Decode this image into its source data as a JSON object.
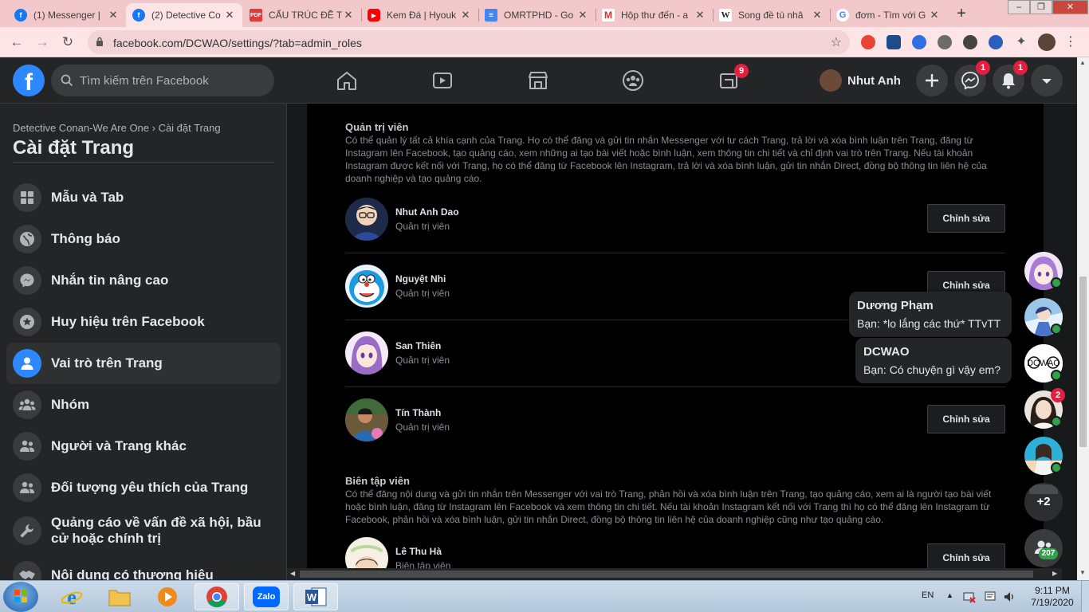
{
  "browser": {
    "tabs": [
      {
        "title": "(1) Messenger |",
        "favicon": "facebook-icon",
        "color": "#1877f2"
      },
      {
        "title": "(2) Detective Co",
        "favicon": "facebook-icon",
        "color": "#1877f2",
        "active": true
      },
      {
        "title": "CẤU TRÚC ĐỀ T",
        "favicon": "pdf-icon",
        "color": "#e53935"
      },
      {
        "title": "Kem Đá | Hyouk",
        "favicon": "youtube-icon",
        "color": "#ff0000"
      },
      {
        "title": "OMRTPHD - Go",
        "favicon": "docs-icon",
        "color": "#4285f4"
      },
      {
        "title": "Hộp thư đến - a",
        "favicon": "gmail-icon",
        "color": "#d93025"
      },
      {
        "title": "Song đề tù nhâ",
        "favicon": "wikipedia-icon",
        "color": "#555555"
      },
      {
        "title": "đơm - Tìm với G",
        "favicon": "google-icon",
        "color": "#4285f4"
      }
    ],
    "url": "facebook.com/DCWAO/settings/?tab=admin_roles"
  },
  "fb_header": {
    "search_placeholder": "Tìm kiếm trên Facebook",
    "groups_badge": "9",
    "profile_name": "Nhut Anh",
    "messenger_badge": "1",
    "notifications_badge": "1"
  },
  "sidebar": {
    "breadcrumb": "Detective Conan-We Are One › Cài đặt Trang",
    "title": "Cài đặt Trang",
    "items": [
      {
        "label": "Mẫu và Tab",
        "icon": "grid-icon"
      },
      {
        "label": "Thông báo",
        "icon": "globe-icon"
      },
      {
        "label": "Nhắn tin nâng cao",
        "icon": "messenger-icon"
      },
      {
        "label": "Huy hiệu trên Facebook",
        "icon": "star-badge-icon"
      },
      {
        "label": "Vai trò trên Trang",
        "icon": "person-icon",
        "active": true
      },
      {
        "label": "Nhóm",
        "icon": "group-icon"
      },
      {
        "label": "Người và Trang khác",
        "icon": "group-icon"
      },
      {
        "label": "Đối tượng yêu thích của Trang",
        "icon": "group-icon"
      },
      {
        "label": "Quảng cáo về vấn đề xã hội, bầu cử hoặc chính trị",
        "icon": "wrench-icon"
      },
      {
        "label": "Nội dung có thương hiệu",
        "icon": "handshake-icon"
      }
    ]
  },
  "main": {
    "admin_section": {
      "title": "Quản trị viên",
      "description": "Có thể quản lý tất cả khía cạnh của Trang. Họ có thể đăng và gửi tin nhắn Messenger với tư cách Trang, trả lời và xóa bình luận trên Trang, đăng từ Instagram lên Facebook, tạo quảng cáo, xem những ai tạo bài viết hoặc bình luận, xem thông tin chi tiết và chỉ định vai trò trên Trang. Nếu tài khoản Instagram được kết nối với Trang, họ có thể đăng từ Facebook lên Instagram, trả lời và xóa bình luận, gửi tin nhắn Direct, đồng bộ thông tin liên hệ của doanh nghiệp và tạo quảng cáo.",
      "people": [
        {
          "name": "Nhut Anh Dao",
          "role": "Quản trị viên",
          "edit_label": "Chỉnh sửa"
        },
        {
          "name": "Nguyệt Nhi",
          "role": "Quản trị viên",
          "edit_label": "Chỉnh sửa"
        },
        {
          "name": "San Thiên",
          "role": "Quản trị viên",
          "edit_label": "Chỉnh sửa"
        },
        {
          "name": "Tín Thành",
          "role": "Quản trị viên",
          "edit_label": "Chỉnh sửa"
        }
      ]
    },
    "editor_section": {
      "title": "Biên tập viên",
      "description": "Có thể đăng nội dung và gửi tin nhắn trên Messenger với vai trò Trang, phản hồi và xóa bình luận trên Trang, tạo quảng cáo, xem ai là người tạo bài viết hoặc bình luận, đăng từ Instagram lên Facebook và xem thông tin chi tiết. Nếu tài khoản Instagram kết nối với Trang thì họ có thể đăng lên Instagram từ Facebook, phản hồi và xóa bình luận, gửi tin nhắn Direct, đồng bộ thông tin liên hệ của doanh nghiệp cũng như tạo quảng cáo.",
      "people": [
        {
          "name": "Lê Thu Hà",
          "role": "Biên tập viên",
          "edit_label": "Chỉnh sửa"
        }
      ]
    }
  },
  "chat": {
    "bubbles": [
      {
        "name": "Dương Phạm",
        "message": "Bạn: *lo lắng các thứ* TTvTT"
      },
      {
        "name": "DCWAO",
        "message": "Bạn: Có chuyện gì vậy em?"
      }
    ],
    "dcwao_logo": "DCWAO",
    "unread_badge": "2",
    "more_count": "+2",
    "contacts_count": "207"
  },
  "taskbar": {
    "lang": "EN",
    "time": "9:11 PM",
    "date": "7/19/2020",
    "zalo_label": "Zalo"
  }
}
